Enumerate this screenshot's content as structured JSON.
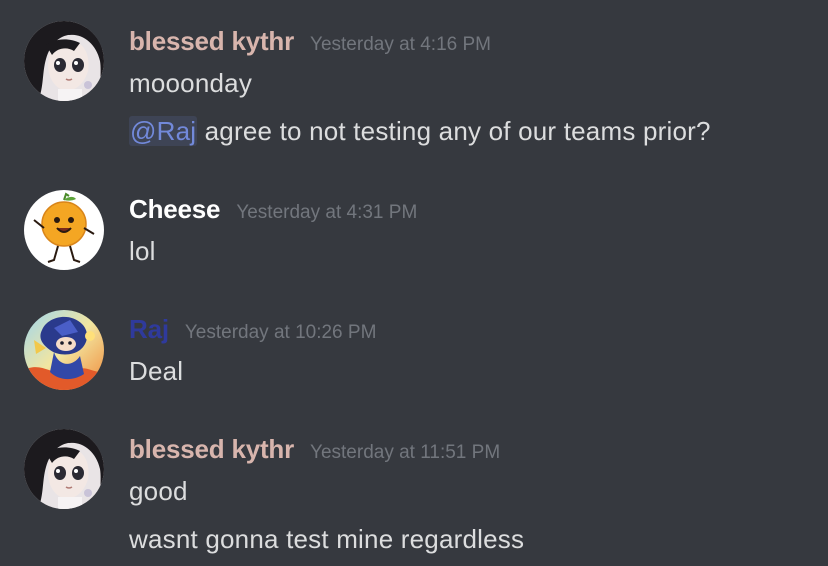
{
  "colors": {
    "background": "#36393f",
    "timestamp": "#72767d",
    "text": "#dcddde",
    "mention": "#7289da",
    "kythr_name": "#d8b5ad",
    "cheese_name": "#ffffff",
    "raj_name": "#2f3a9c"
  },
  "messages": [
    {
      "author": "blessed kythr",
      "timestamp": "Yesterday at 4:16 PM",
      "avatar_icon": "anime-girl-avatar-icon",
      "lines": [
        {
          "text": "mooonday"
        },
        {
          "mention": "@Raj",
          "text": " agree to not testing any of our teams prior?"
        }
      ]
    },
    {
      "author": "Cheese",
      "timestamp": "Yesterday at 4:31 PM",
      "avatar_icon": "orange-character-avatar-icon",
      "lines": [
        {
          "text": "lol"
        }
      ]
    },
    {
      "author": "Raj",
      "timestamp": "Yesterday at 10:26 PM",
      "avatar_icon": "colorful-character-avatar-icon",
      "lines": [
        {
          "text": "Deal"
        }
      ]
    },
    {
      "author": "blessed kythr",
      "timestamp": "Yesterday at 11:51 PM",
      "avatar_icon": "anime-girl-avatar-icon",
      "lines": [
        {
          "text": "good"
        },
        {
          "text": "wasnt gonna test mine regardless"
        }
      ]
    }
  ]
}
